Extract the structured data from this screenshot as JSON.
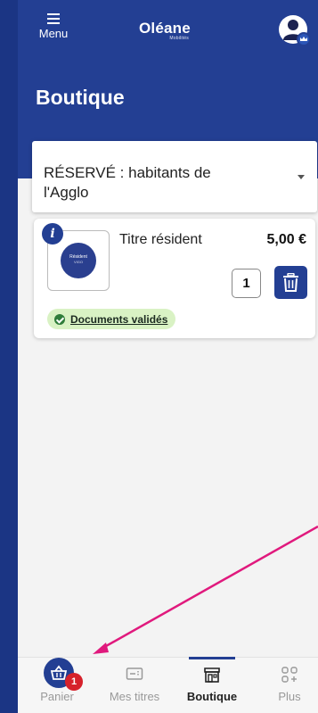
{
  "header": {
    "menu_label": "Menu",
    "logo_text": "Oléane",
    "logo_sub": "Mobilités"
  },
  "page": {
    "title": "Boutique"
  },
  "category_select": {
    "selected": "RÉSERVÉ : habitants de l'Agglo"
  },
  "cart_item": {
    "thumb_title": "Résident",
    "thumb_sub": "VIGO",
    "name": "Titre résident",
    "price": "5,00 €",
    "quantity": "1",
    "info_glyph": "i",
    "status_label": "Documents validés"
  },
  "bottom_nav": {
    "items": [
      {
        "label": "Panier",
        "icon": "basket-icon",
        "badge": "1"
      },
      {
        "label": "Mes titres",
        "icon": "ticket-icon"
      },
      {
        "label": "Boutique",
        "icon": "store-icon"
      },
      {
        "label": "Plus",
        "icon": "grid-plus-icon"
      }
    ],
    "active": "Boutique"
  },
  "colors": {
    "brand": "#233f93",
    "badge_red": "#d6212b",
    "validated_bg": "#d9f2c4",
    "annotation_arrow": "#e0197d"
  }
}
